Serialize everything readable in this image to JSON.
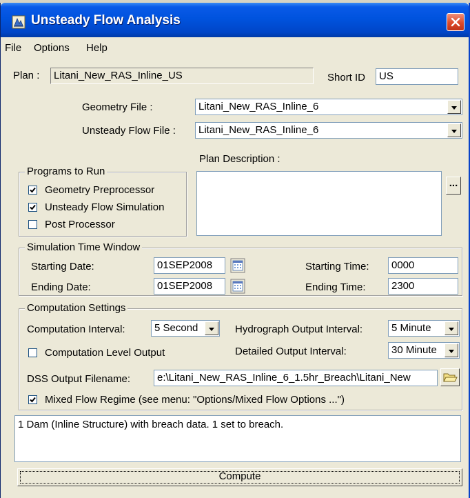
{
  "window": {
    "title": "Unsteady Flow Analysis"
  },
  "menu": [
    "File",
    "Options",
    "Help"
  ],
  "plan": {
    "label": "Plan :",
    "value": "Litani_New_RAS_Inline_US",
    "short_id_label": "Short ID",
    "short_id_value": "US"
  },
  "geometry": {
    "label": "Geometry File :",
    "value": "Litani_New_RAS_Inline_6"
  },
  "unsteady": {
    "label": "Unsteady Flow File :",
    "value": "Litani_New_RAS_Inline_6"
  },
  "programs": {
    "title": "Programs to Run",
    "items": [
      {
        "label": "Geometry Preprocessor",
        "checked": true
      },
      {
        "label": "Unsteady Flow Simulation",
        "checked": true
      },
      {
        "label": "Post Processor",
        "checked": false
      }
    ]
  },
  "plan_description": {
    "label": "Plan Description :",
    "button_label": "...",
    "value": ""
  },
  "time_window": {
    "title": "Simulation Time Window",
    "starting_date_label": "Starting Date:",
    "starting_date": "01SEP2008",
    "ending_date_label": "Ending Date:",
    "ending_date": "01SEP2008",
    "starting_time_label": "Starting Time:",
    "starting_time": "0000",
    "ending_time_label": "Ending Time:",
    "ending_time": "2300"
  },
  "computation": {
    "title": "Computation Settings",
    "interval_label": "Computation Interval:",
    "interval_value": "5 Second",
    "hydrograph_label": "Hydrograph Output Interval:",
    "hydrograph_value": "5 Minute",
    "level_output_label": "Computation Level Output",
    "level_output_checked": false,
    "detailed_label": "Detailed Output Interval:",
    "detailed_value": "30 Minute",
    "dss_label": "DSS Output Filename:",
    "dss_value": "e:\\Litani_New_RAS_Inline_6_1.5hr_Breach\\Litani_New",
    "mixed_flow_label": "Mixed Flow Regime (see menu: \"Options/Mixed Flow Options ...\")",
    "mixed_flow_checked": true
  },
  "status": {
    "message": "1 Dam (Inline Structure) with breach data. 1 set to breach."
  },
  "compute": {
    "label": "Compute"
  },
  "colors": {
    "titlebar": "#0053de",
    "face": "#ece9d8",
    "close": "#dc4a2a"
  }
}
